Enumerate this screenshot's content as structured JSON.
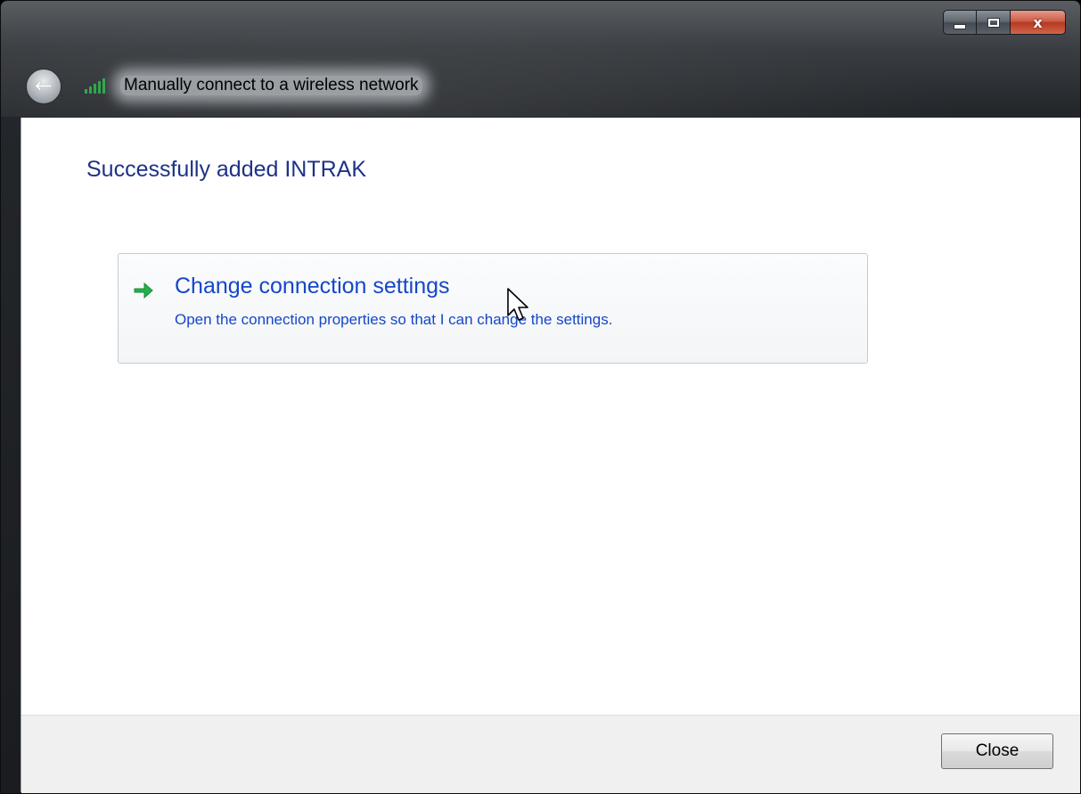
{
  "window": {
    "title": "Manually connect to a wireless network",
    "close_glyph": "x"
  },
  "icons": {
    "title": "wifi-signal-icon",
    "back": "back-arrow-icon",
    "link": "green-arrow-icon"
  },
  "content": {
    "heading": "Successfully added INTRAK",
    "command_link": {
      "title": "Change connection settings",
      "description": "Open the connection properties so that I can change the settings."
    }
  },
  "footer": {
    "close_label": "Close"
  },
  "colors": {
    "heading": "#1e3287",
    "link": "#1547c8",
    "arrow": "#22b14c"
  }
}
